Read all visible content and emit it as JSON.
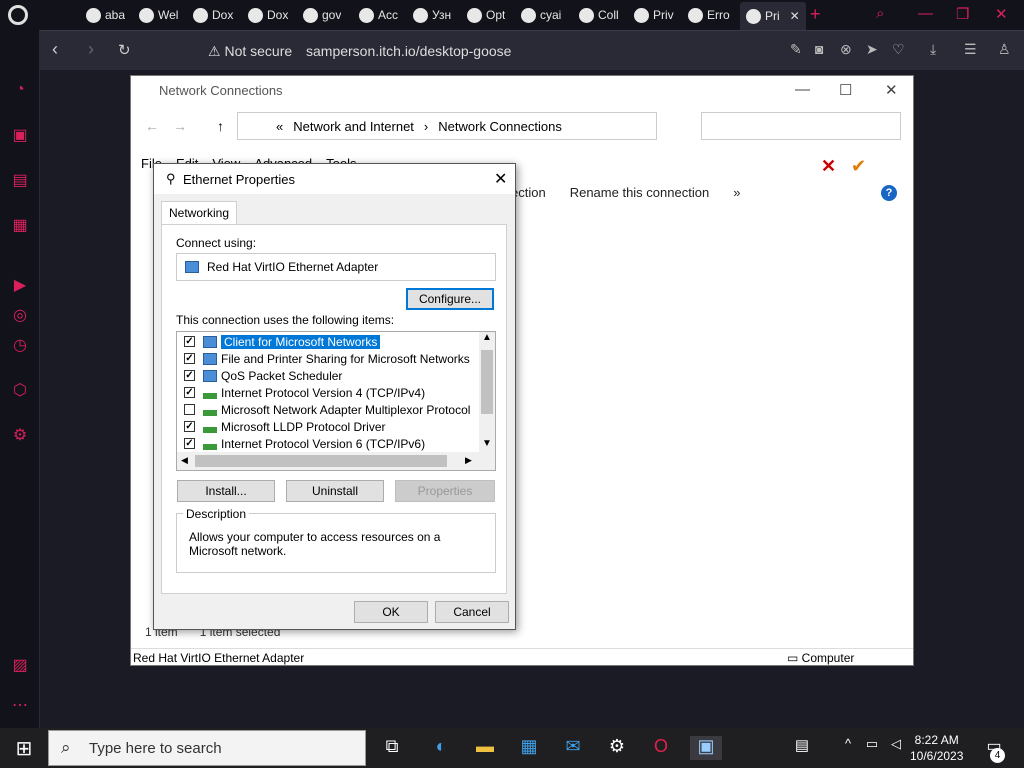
{
  "browser": {
    "tabs": [
      {
        "label": "aba",
        "icon": "youtube-icon"
      },
      {
        "label": "Wel",
        "icon": "globe-icon"
      },
      {
        "label": "Dox",
        "icon": "globe-icon"
      },
      {
        "label": "Dox",
        "icon": "globe-icon"
      },
      {
        "label": "gov",
        "icon": "google-icon"
      },
      {
        "label": "Acc",
        "icon": "globe-icon"
      },
      {
        "label": "Узн",
        "icon": "badge-icon"
      },
      {
        "label": "Opt",
        "icon": "bracket-icon"
      },
      {
        "label": "cyai",
        "icon": "google-icon"
      },
      {
        "label": "Coll",
        "icon": "reddit-icon"
      },
      {
        "label": "Priv",
        "icon": "android-icon"
      },
      {
        "label": "Erro",
        "icon": "google-icon"
      },
      {
        "label": "Pri",
        "icon": "globe-icon",
        "active": true
      }
    ],
    "address": {
      "security_label": "Not secure",
      "url": "samperson.itch.io/desktop-goose"
    }
  },
  "explorer": {
    "title": "Network Connections",
    "breadcrumb": [
      "«",
      "Network and Internet",
      "›",
      "Network Connections"
    ],
    "menu": [
      "File",
      "Edit",
      "View",
      "Advanced",
      "Tools"
    ],
    "toolbar": [
      "ection",
      "Rename this connection",
      "»"
    ],
    "status": {
      "count": "1 item",
      "selected": "1 item selected"
    },
    "bottom_left": "Red Hat VirtIO Ethernet Adapter",
    "bottom_right": "Computer"
  },
  "dialog": {
    "title": "Ethernet Properties",
    "tab": "Networking",
    "connect_using_label": "Connect using:",
    "adapter_name": "Red Hat VirtIO Ethernet Adapter",
    "configure_label": "Configure...",
    "items_label": "This connection uses the following items:",
    "items": [
      {
        "label": "Client for Microsoft Networks",
        "checked": true,
        "icon": "network-client-icon",
        "selected": true
      },
      {
        "label": "File and Printer Sharing for Microsoft Networks",
        "checked": true,
        "icon": "network-client-icon"
      },
      {
        "label": "QoS Packet Scheduler",
        "checked": true,
        "icon": "network-client-icon"
      },
      {
        "label": "Internet Protocol Version 4 (TCP/IPv4)",
        "checked": true,
        "icon": "protocol-icon"
      },
      {
        "label": "Microsoft Network Adapter Multiplexor Protocol",
        "checked": false,
        "icon": "protocol-icon"
      },
      {
        "label": "Microsoft LLDP Protocol Driver",
        "checked": true,
        "icon": "protocol-icon"
      },
      {
        "label": "Internet Protocol Version 6 (TCP/IPv6)",
        "checked": true,
        "icon": "protocol-icon"
      }
    ],
    "install_label": "Install...",
    "uninstall_label": "Uninstall",
    "properties_label": "Properties",
    "description_legend": "Description",
    "description_text": "Allows your computer to access resources on a Microsoft network.",
    "ok_label": "OK",
    "cancel_label": "Cancel"
  },
  "taskbar": {
    "search_placeholder": "Type here to search",
    "time": "8:22 AM",
    "date": "10/6/2023",
    "notification_count": "4"
  },
  "colors": {
    "accent": "#d9205c",
    "selection": "#0078d7"
  }
}
